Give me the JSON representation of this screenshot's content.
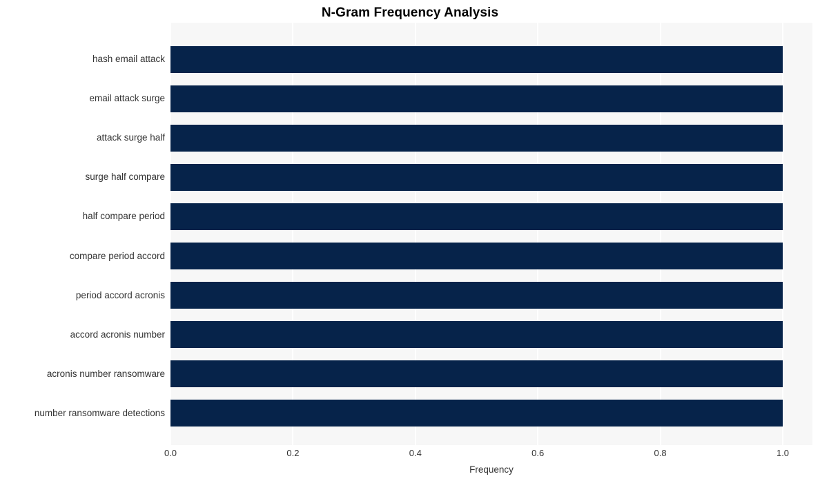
{
  "chart_data": {
    "type": "bar",
    "orientation": "horizontal",
    "title": "N-Gram Frequency Analysis",
    "xlabel": "Frequency",
    "ylabel": "",
    "categories": [
      "hash email attack",
      "email attack surge",
      "attack surge half",
      "surge half compare",
      "half compare period",
      "compare period accord",
      "period accord acronis",
      "accord acronis number",
      "acronis number ransomware",
      "number ransomware detections"
    ],
    "values": [
      1.0,
      1.0,
      1.0,
      1.0,
      1.0,
      1.0,
      1.0,
      1.0,
      1.0,
      1.0
    ],
    "xlim": [
      0.0,
      1.0
    ],
    "xticks": [
      "0.0",
      "0.2",
      "0.4",
      "0.6",
      "0.8",
      "1.0"
    ],
    "xtick_values": [
      0.0,
      0.2,
      0.4,
      0.6,
      0.8,
      1.0
    ],
    "grid": true,
    "grid_axis": "x",
    "legend": null,
    "colors": {
      "bar": "#06234a",
      "plot_background": "#f7f7f7",
      "gridline": "#ffffff",
      "figure_background": "#ffffff",
      "text": "#333333",
      "title": "#000000"
    }
  }
}
